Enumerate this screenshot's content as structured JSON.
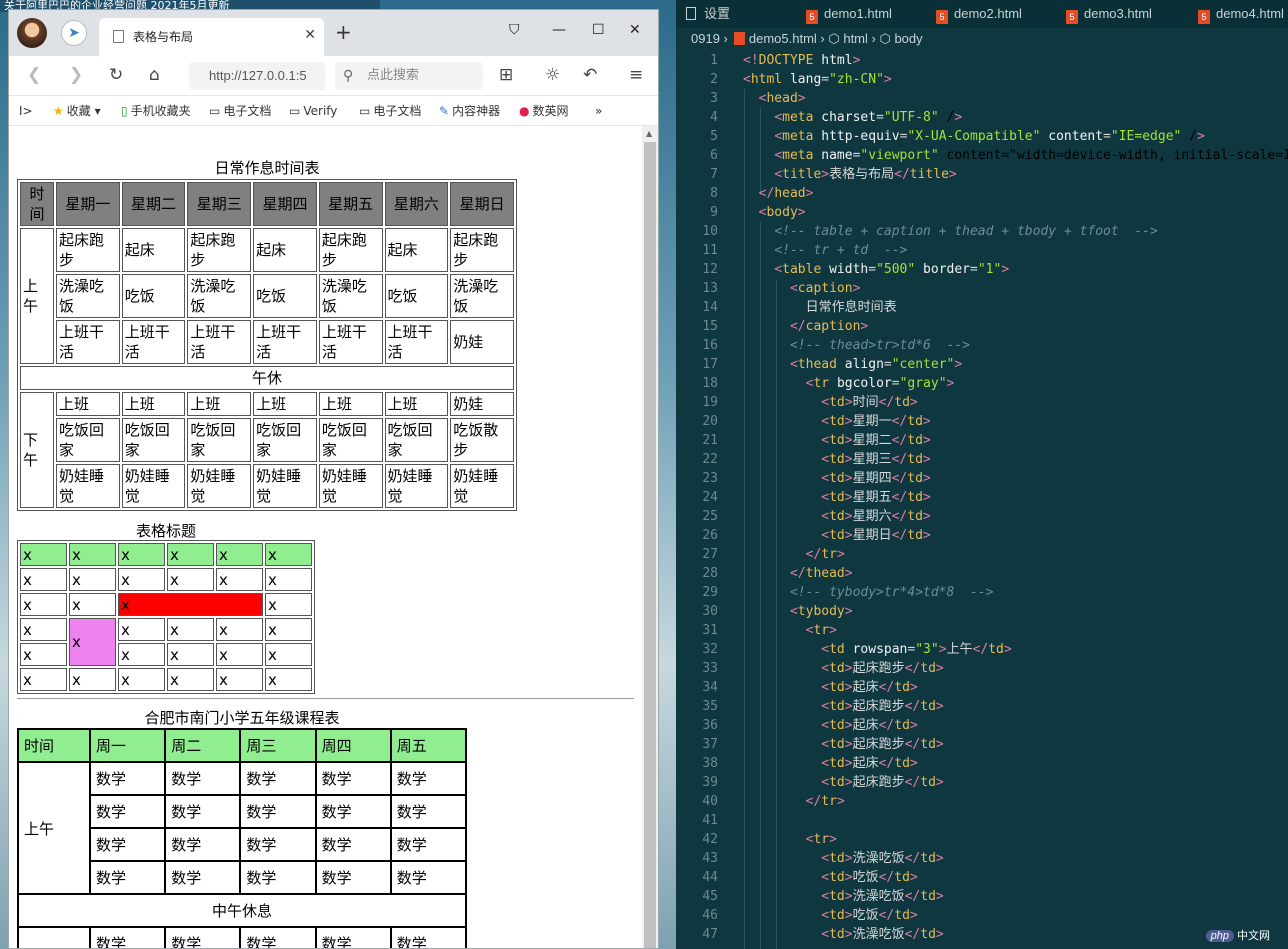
{
  "desktop": {
    "top_text": "关于阿里巴巴的企业经营问题 2021年5月更新"
  },
  "browser": {
    "tab_title": "表格与布局",
    "url": "http://127.0.0.1:5",
    "search_placeholder": "点此搜索",
    "bookmarks": [
      "收藏",
      "手机收藏夹",
      "电子文档",
      "Verify",
      "电子文档",
      "内容神器",
      "数英网",
      "»"
    ]
  },
  "table1": {
    "caption": "日常作息时间表",
    "header": [
      "时间",
      "星期一",
      "星期二",
      "星期三",
      "星期四",
      "星期五",
      "星期六",
      "星期日"
    ],
    "morning_label": "上午",
    "morning_rows": [
      [
        "起床跑步",
        "起床",
        "起床跑步",
        "起床",
        "起床跑步",
        "起床",
        "起床跑步"
      ],
      [
        "洗澡吃饭",
        "吃饭",
        "洗澡吃饭",
        "吃饭",
        "洗澡吃饭",
        "吃饭",
        "洗澡吃饭"
      ],
      [
        "上班干活",
        "上班干活",
        "上班干活",
        "上班干活",
        "上班干活",
        "上班干活",
        "奶娃"
      ]
    ],
    "noon": "午休",
    "afternoon_label": "下午",
    "afternoon_rows": [
      [
        "上班",
        "上班",
        "上班",
        "上班",
        "上班",
        "上班",
        "奶娃"
      ],
      [
        "吃饭回家",
        "吃饭回家",
        "吃饭回家",
        "吃饭回家",
        "吃饭回家",
        "吃饭回家",
        "吃饭散步"
      ],
      [
        "奶娃睡觉",
        "奶娃睡觉",
        "奶娃睡觉",
        "奶娃睡觉",
        "奶娃睡觉",
        "奶娃睡觉",
        "奶娃睡觉"
      ]
    ]
  },
  "table2": {
    "caption": "表格标题",
    "cell": "x",
    "colors": {
      "header": "#90ee90",
      "red": "#ff0000",
      "violet": "#ee82ee"
    }
  },
  "table3": {
    "caption": "合肥市南门小学五年级课程表",
    "header": [
      "时间",
      "周一",
      "周二",
      "周三",
      "周四",
      "周五"
    ],
    "morning_label": "上午",
    "subject": "数学",
    "noon": "中午休息"
  },
  "editor": {
    "tabs": [
      "设置",
      "demo1.html",
      "demo2.html",
      "demo3.html",
      "demo4.html"
    ],
    "breadcrumb": [
      "0919",
      "demo5.html",
      "html",
      "body"
    ],
    "lines": [
      "<!DOCTYPE html>",
      "<html lang=\"zh-CN\">",
      "  <head>",
      "    <meta charset=\"UTF-8\" />",
      "    <meta http-equiv=\"X-UA-Compatible\" content=\"IE=edge\" />",
      "    <meta name=\"viewport\" content=\"width=device-width, initial-scale=1.",
      "    <title>表格与布局</title>",
      "  </head>",
      "  <body>",
      "    <!-- table + caption + thead + tbody + tfoot  -->",
      "    <!-- tr + td  -->",
      "    <table width=\"500\" border=\"1\">",
      "      <caption>",
      "        日常作息时间表",
      "      </caption>",
      "      <!-- thead>tr>td*6  -->",
      "      <thead align=\"center\">",
      "        <tr bgcolor=\"gray\">",
      "          <td>时间</td>",
      "          <td>星期一</td>",
      "          <td>星期二</td>",
      "          <td>星期三</td>",
      "          <td>星期四</td>",
      "          <td>星期五</td>",
      "          <td>星期六</td>",
      "          <td>星期日</td>",
      "        </tr>",
      "      </thead>",
      "      <!-- tybody>tr*4>td*8  -->",
      "      <tybody>",
      "        <tr>",
      "          <td rowspan=\"3\">上午</td>",
      "          <td>起床跑步</td>",
      "          <td>起床</td>",
      "          <td>起床跑步</td>",
      "          <td>起床</td>",
      "          <td>起床跑步</td>",
      "          <td>起床</td>",
      "          <td>起床跑步</td>",
      "        </tr>",
      "",
      "        <tr>",
      "          <td>洗澡吃饭</td>",
      "          <td>吃饭</td>",
      "          <td>洗澡吃饭</td>",
      "          <td>吃饭</td>",
      "          <td>洗澡吃饭</td>"
    ],
    "watermark": "中文网"
  }
}
